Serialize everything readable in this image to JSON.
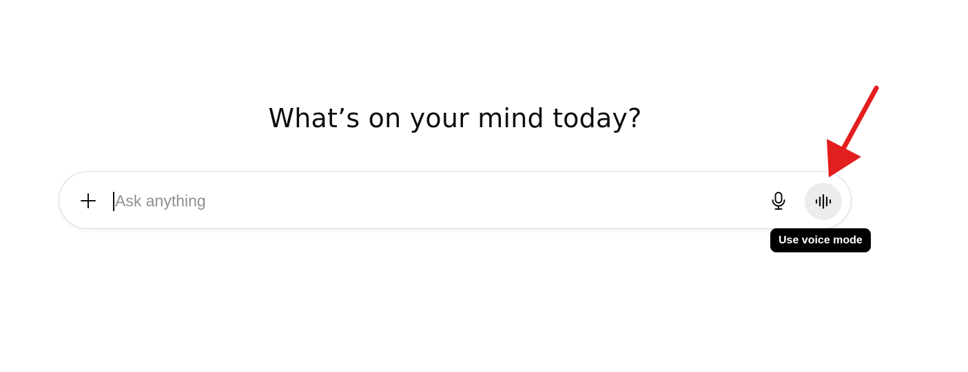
{
  "main": {
    "heading": "What’s on your mind today?"
  },
  "composer": {
    "placeholder": "Ask anything",
    "value": "",
    "attach_icon": "plus-icon",
    "dictate_icon": "microphone-icon",
    "voice_icon": "waveform-icon"
  },
  "tooltip": {
    "text": "Use voice mode"
  },
  "annotation": {
    "arrow_color": "#e31e1e"
  }
}
